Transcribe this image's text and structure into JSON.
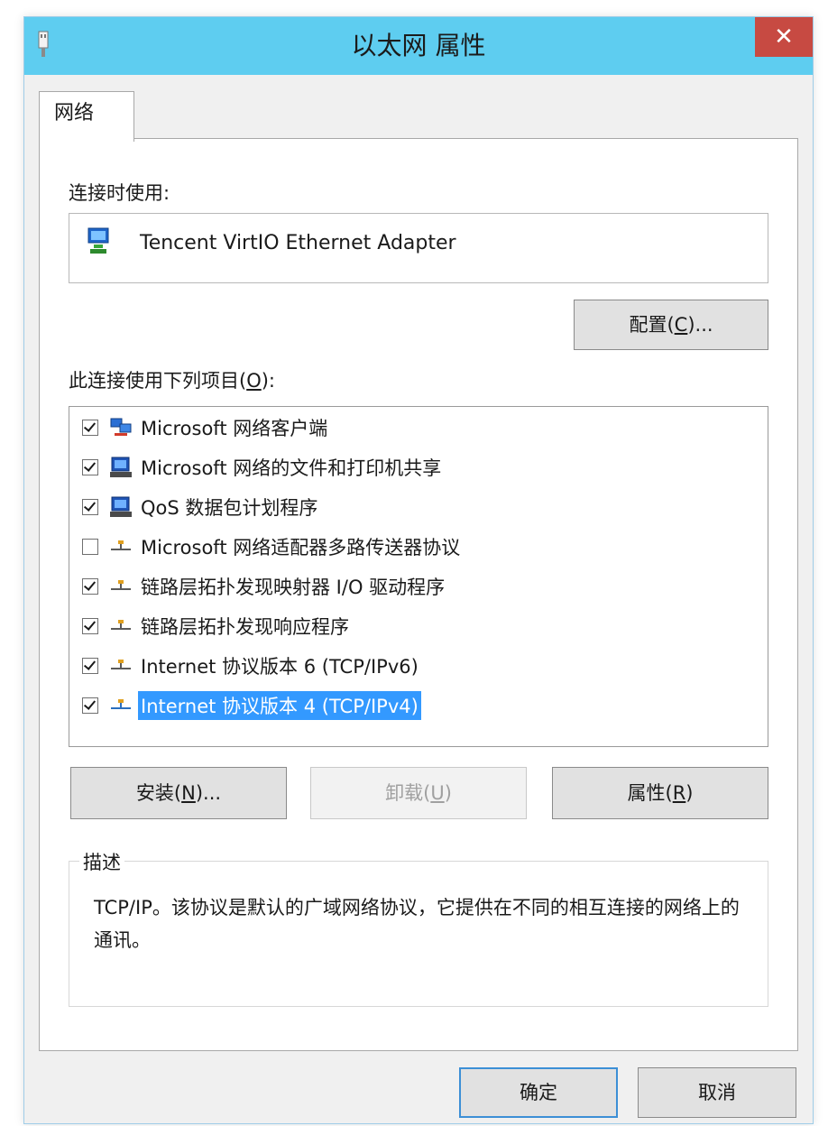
{
  "window": {
    "title": "以太网 属性",
    "close_glyph": "✕"
  },
  "tabs": [
    {
      "label": "网络"
    }
  ],
  "connect_using": {
    "label": "连接时使用:",
    "adapter_name": "Tencent VirtIO Ethernet Adapter",
    "adapter_icon": "network-adapter-icon"
  },
  "configure_button": {
    "label_pre": "配置(",
    "hotkey": "C",
    "label_post": ")..."
  },
  "items_label": {
    "pre": "此连接使用下列项目(",
    "hotkey": "O",
    "post": "):"
  },
  "items": [
    {
      "label": "Microsoft 网络客户端",
      "checked": true,
      "icon": "client-icon",
      "selected": false
    },
    {
      "label": "Microsoft 网络的文件和打印机共享",
      "checked": true,
      "icon": "service-icon",
      "selected": false
    },
    {
      "label": "QoS 数据包计划程序",
      "checked": true,
      "icon": "service-icon",
      "selected": false
    },
    {
      "label": "Microsoft 网络适配器多路传送器协议",
      "checked": false,
      "icon": "protocol-icon",
      "selected": false
    },
    {
      "label": "链路层拓扑发现映射器 I/O 驱动程序",
      "checked": true,
      "icon": "protocol-icon",
      "selected": false
    },
    {
      "label": "链路层拓扑发现响应程序",
      "checked": true,
      "icon": "protocol-icon",
      "selected": false
    },
    {
      "label": "Internet 协议版本 6 (TCP/IPv6)",
      "checked": true,
      "icon": "protocol-icon",
      "selected": false
    },
    {
      "label": "Internet 协议版本 4 (TCP/IPv4)",
      "checked": true,
      "icon": "protocol-icon",
      "selected": true
    }
  ],
  "buttons": {
    "install": {
      "pre": "安装(",
      "hotkey": "N",
      "post": ")..."
    },
    "uninstall": {
      "pre": "卸载(",
      "hotkey": "U",
      "post": ")"
    },
    "properties": {
      "pre": "属性(",
      "hotkey": "R",
      "post": ")"
    }
  },
  "description": {
    "legend": "描述",
    "text": "TCP/IP。该协议是默认的广域网络协议，它提供在不同的相互连接的网络上的通讯。"
  },
  "footer": {
    "ok": "确定",
    "cancel": "取消"
  },
  "colors": {
    "titlebar": "#5ecdf0",
    "close": "#c74a42",
    "selection": "#3399ff"
  }
}
